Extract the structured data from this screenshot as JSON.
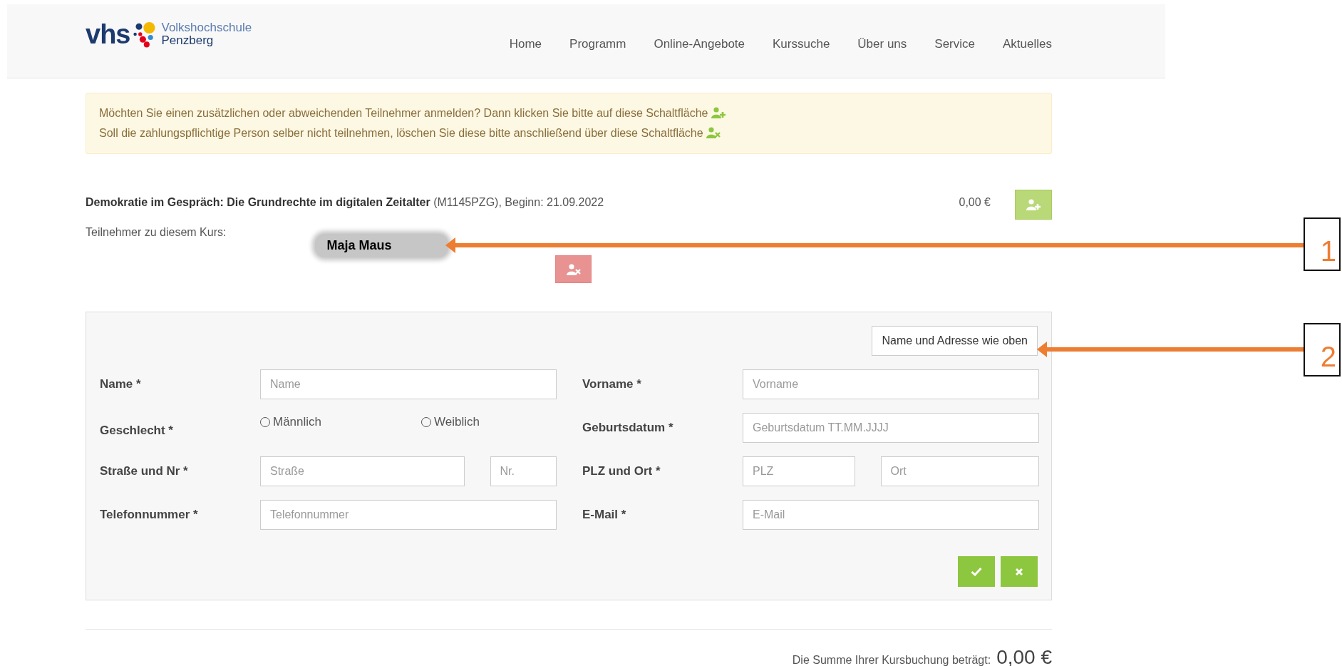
{
  "header": {
    "logo": {
      "mark": "vhs",
      "line_1": "Volkshochschule",
      "line_2": "Penzberg"
    },
    "nav": [
      {
        "label": "Home"
      },
      {
        "label": "Programm"
      },
      {
        "label": "Online-Angebote"
      },
      {
        "label": "Kurssuche"
      },
      {
        "label": "Über uns"
      },
      {
        "label": "Service"
      },
      {
        "label": "Aktuelles"
      }
    ]
  },
  "notice": {
    "lines": [
      "Möchten Sie einen zusätzlichen oder abweichenden Teilnehmer anmelden? Dann klicken Sie bitte auf diese Schaltfläche",
      "Soll die zahlungspflichtige Person selber nicht teilnehmen, löschen Sie diese bitte anschließend über diese Schaltfläche"
    ]
  },
  "course": {
    "title": "Demokratie im Gespräch: Die Grundrechte im digitalen Zeitalter",
    "details": "(M1145PZG), Beginn: 21.09.2022",
    "price": "0,00 €",
    "participants_label": "Teilnehmer zu diesem Kurs:",
    "participant": "Maja Maus"
  },
  "form": {
    "copy_button": "Name und Adresse wie oben",
    "fields": [
      {
        "kind": "text",
        "label": "Name *",
        "inputs": [
          {
            "placeholder": "Name"
          }
        ]
      },
      {
        "kind": "text",
        "label": "Vorname *",
        "inputs": [
          {
            "placeholder": "Vorname"
          }
        ]
      },
      {
        "kind": "radio",
        "label": "Geschlecht *",
        "options": [
          {
            "label": "Männlich",
            "selected": false
          },
          {
            "label": "Weiblich",
            "selected": false
          }
        ]
      },
      {
        "kind": "text",
        "label": "Geburtsdatum *",
        "inputs": [
          {
            "placeholder": "Geburtsdatum TT.MM.JJJJ"
          }
        ]
      },
      {
        "kind": "text",
        "label": "Straße und Nr *",
        "inputs": [
          {
            "placeholder": "Straße"
          },
          {
            "placeholder": "Nr."
          }
        ]
      },
      {
        "kind": "text",
        "label": "PLZ und Ort *",
        "inputs": [
          {
            "placeholder": "PLZ"
          },
          {
            "placeholder": "Ort"
          }
        ]
      },
      {
        "kind": "text",
        "label": "Telefonnummer *",
        "inputs": [
          {
            "placeholder": "Telefonnummer"
          }
        ]
      },
      {
        "kind": "text",
        "label": "E-Mail *",
        "inputs": [
          {
            "placeholder": "E-Mail"
          }
        ]
      }
    ]
  },
  "total": {
    "label": "Die Summe Ihrer Kursbuchung beträgt:",
    "amount": "0,00 €"
  },
  "annotations": [
    {
      "number": "1"
    },
    {
      "number": "2"
    }
  ]
}
